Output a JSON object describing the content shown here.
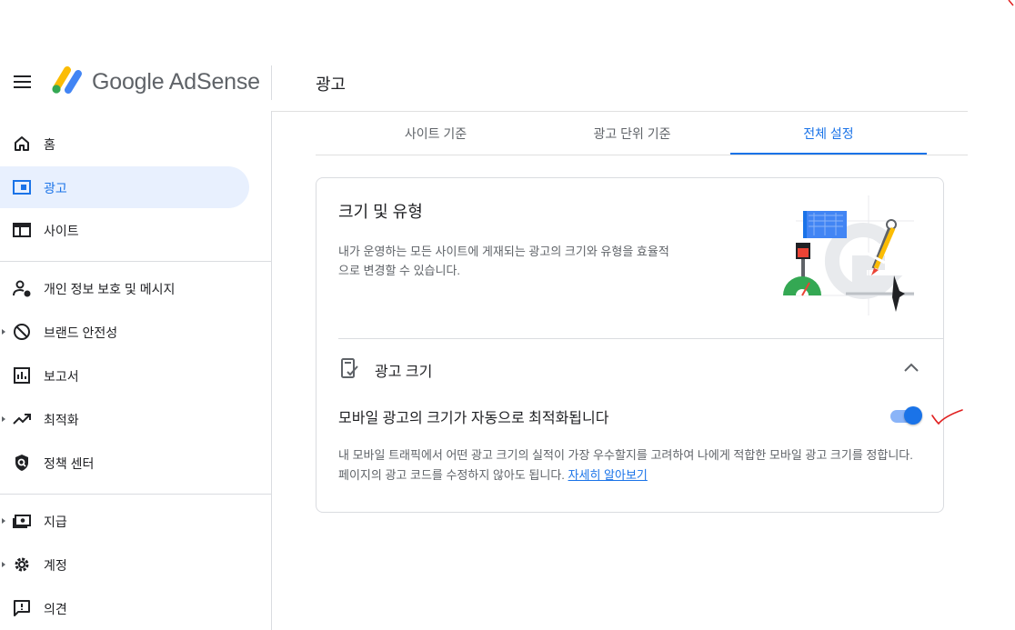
{
  "header": {
    "brand_google": "Google",
    "brand_product": "AdSense",
    "page_title": "광고"
  },
  "sidebar": {
    "items": [
      {
        "label": "홈",
        "icon": "home-icon"
      },
      {
        "label": "광고",
        "icon": "ads-icon",
        "active": true
      },
      {
        "label": "사이트",
        "icon": "sites-icon"
      },
      {
        "label": "개인 정보 보호 및 메시지",
        "icon": "privacy-icon"
      },
      {
        "label": "브랜드 안전성",
        "icon": "block-icon",
        "expandable": true
      },
      {
        "label": "보고서",
        "icon": "reports-icon"
      },
      {
        "label": "최적화",
        "icon": "trending-icon",
        "expandable": true
      },
      {
        "label": "정책 센터",
        "icon": "policy-shield-icon"
      },
      {
        "label": "지급",
        "icon": "payments-icon",
        "expandable": true
      },
      {
        "label": "계정",
        "icon": "gear-icon",
        "expandable": true
      },
      {
        "label": "의견",
        "icon": "feedback-icon"
      }
    ]
  },
  "tabs": [
    {
      "label": "사이트 기준"
    },
    {
      "label": "광고 단위 기준"
    },
    {
      "label": "전체 설정",
      "active": true
    }
  ],
  "card": {
    "title": "크기 및 유형",
    "description": "내가 운영하는 모든 사이트에 게재되는 광고의 크기와 유형을 효율적으로 변경할 수 있습니다.",
    "section": {
      "title": "광고 크기",
      "setting_label": "모바일 광고의 크기가 자동으로 최적화됩니다",
      "toggle_on": true,
      "help_text": "내 모바일 트래픽에서 어떤 광고 크기의 실적이 가장 우수할지를 고려하여 나에게 적합한 모바일 광고 크기를 정합니다. 페이지의 광고 코드를 수정하지 않아도 됩니다. ",
      "help_link": "자세히 알아보기"
    }
  },
  "colors": {
    "accent": "#1a73e8",
    "active_bg": "#e8f0fe",
    "annotation": "#e02020"
  }
}
